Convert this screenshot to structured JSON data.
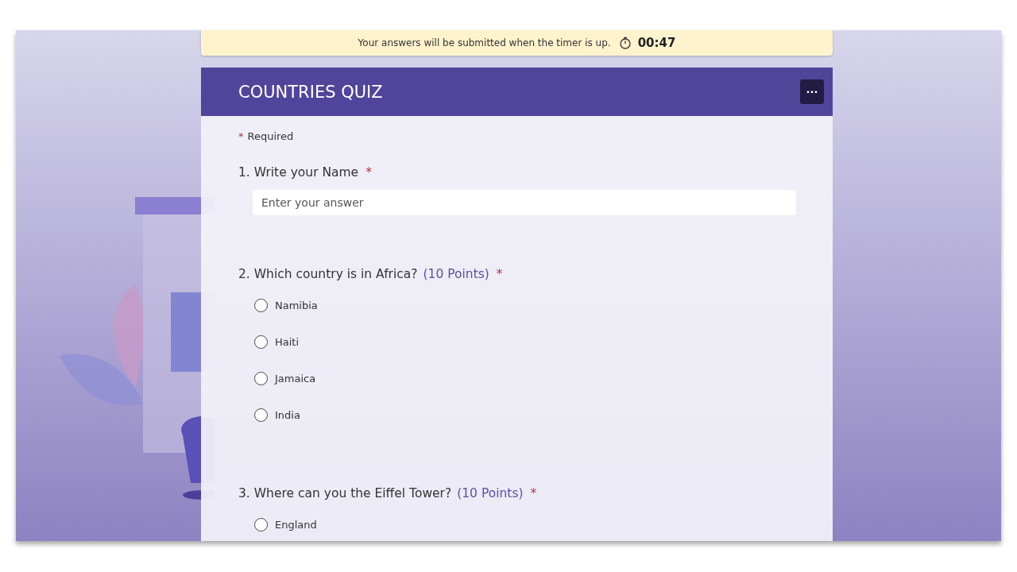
{
  "timer_banner": {
    "message": "Your answers will be submitted when the timer is up.",
    "time": "00:47"
  },
  "form": {
    "title": "COUNTRIES QUIZ",
    "more_button": "···",
    "required_note": {
      "mark": "*",
      "text": "Required"
    },
    "questions": [
      {
        "kind": "text",
        "number": "1.",
        "text": "Write your Name",
        "required": true,
        "placeholder": "Enter your answer"
      },
      {
        "kind": "choice",
        "number": "2.",
        "text": "Which country is in Africa?",
        "points": "(10 Points)",
        "required": true,
        "options": [
          {
            "label": "Namibia",
            "selected": false
          },
          {
            "label": "Haiti",
            "selected": false
          },
          {
            "label": "Jamaica",
            "selected": false
          },
          {
            "label": "India",
            "selected": false
          }
        ]
      },
      {
        "kind": "choice",
        "number": "3.",
        "text": "Where can you the Eiffel Tower?",
        "points": "(10 Points)",
        "required": true,
        "options": [
          {
            "label": "England",
            "selected": false
          }
        ]
      }
    ]
  }
}
